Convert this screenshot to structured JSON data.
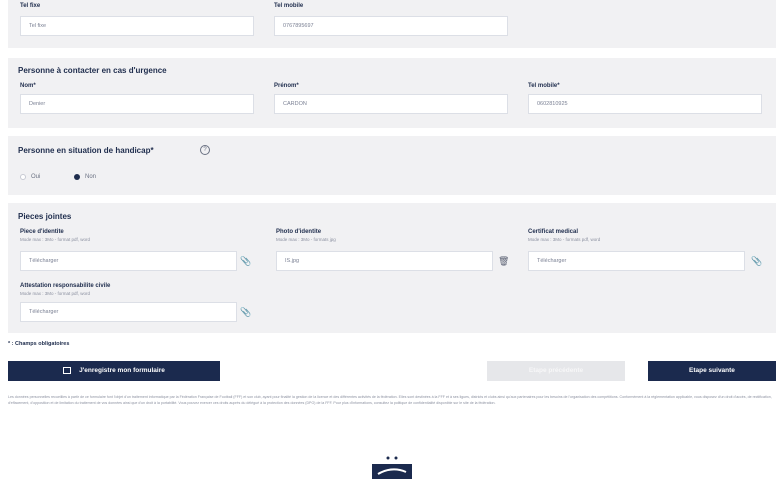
{
  "top": {
    "field1_label": "Tel fixe",
    "field1_value": "Tel fixe",
    "field2_label": "Tel mobile",
    "field2_value": "0767895697"
  },
  "urgence": {
    "title": "Personne à contacter en cas d'urgence",
    "nom_label": "Nom*",
    "nom_value": "Denier",
    "prenom_label": "Prénom*",
    "prenom_value": "CARDON",
    "tel_label": "Tel mobile*",
    "tel_value": "0602810925"
  },
  "handicap": {
    "title": "Personne en situation de handicap*",
    "option_oui": "Oui",
    "option_non": "Non",
    "selected": "Non"
  },
  "pieces": {
    "title": "Pieces jointes",
    "items": [
      {
        "label": "Piece d'identite",
        "sub": "Mode max : 3Mo - format pdf, word",
        "value": "Télécharger",
        "icon": "paperclip-icon"
      },
      {
        "label": "Photo d'identite",
        "sub": "Mode max : 3Mo - formats jpg",
        "value": "IS.jpg",
        "icon": "trash-icon"
      },
      {
        "label": "Certificat medical",
        "sub": "Mode max : 3Mo - formats pdf, word",
        "value": "Télécharger",
        "icon": "paperclip-icon"
      },
      {
        "label": "Attestation responsabilite civile",
        "sub": "Mode max : 3Mo - format pdf, word",
        "value": "Télécharger",
        "icon": "paperclip-icon"
      }
    ]
  },
  "required_note": "* : Champs obligatoires",
  "buttons": {
    "save": "J'enregistre mon formulaire",
    "previous": "Etape précédente",
    "next": "Etape suivante"
  },
  "legal_text": "Les données personnelles recueillies à partir de ce formulaire font l'objet d'un traitement informatique par la Fédération Française de Football (FFF) et son club, ayant pour finalité la gestion de la licence et des différentes activités de la fédération. Elles sont destinées à la FFF et à ses ligues, districts et clubs ainsi qu'aux partenaires pour les besoins de l'organisation des compétitions. Conformément à la réglementation applicable, vous disposez d'un droit d'accès, de rectification, d'effacement, d'opposition et de limitation du traitement de vos données ainsi que d'un droit à la portabilité. Vous pouvez exercer ces droits auprès du délégué à la protection des données (DPO) de la FFF. Pour plus d'informations, consultez la politique de confidentialité disponible sur le site de la fédération.",
  "colors": {
    "navy": "#1b2a4e",
    "panel": "#f1f1f3",
    "disabled": "#e6e7ea"
  }
}
